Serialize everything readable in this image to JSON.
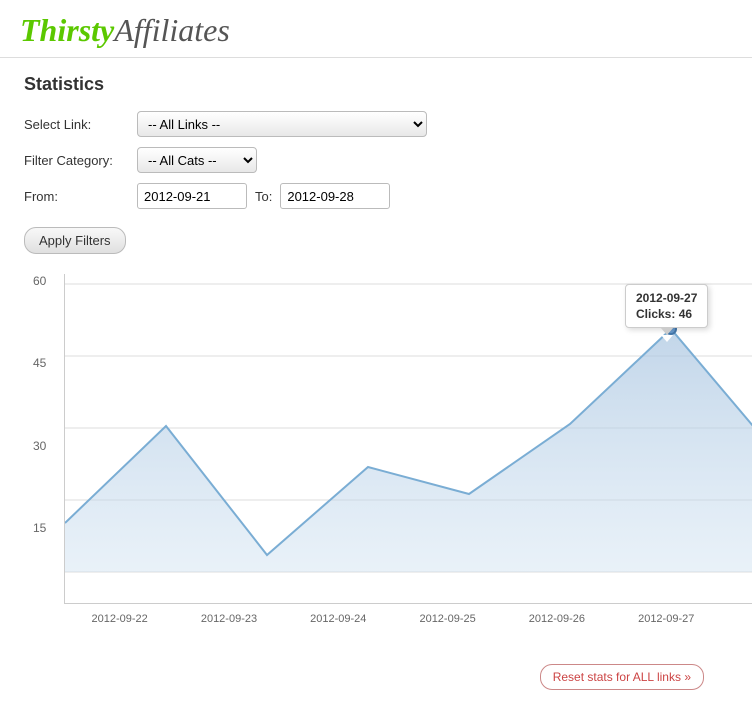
{
  "header": {
    "logo_thirsty": "Thirsty",
    "logo_affiliates": "Affiliates"
  },
  "page": {
    "title": "Statistics"
  },
  "filters": {
    "select_link_label": "Select Link:",
    "select_link_default": "-- All Links --",
    "filter_category_label": "Filter Category:",
    "filter_category_default": "-- All Cats --",
    "from_label": "From:",
    "to_label": "To:",
    "from_value": "2012-09-21",
    "to_value": "2012-09-28",
    "apply_button": "Apply Filters"
  },
  "chart": {
    "y_labels": [
      "60",
      "45",
      "30",
      "15"
    ],
    "x_labels": [
      "2012-09-22",
      "2012-09-23",
      "2012-09-24",
      "2012-09-25",
      "2012-09-26",
      "2012-09-27",
      ""
    ],
    "tooltip": {
      "date": "2012-09-27",
      "clicks_label": "Clicks:",
      "clicks_value": "46"
    }
  },
  "footer": {
    "reset_button": "Reset stats for ALL links »"
  }
}
